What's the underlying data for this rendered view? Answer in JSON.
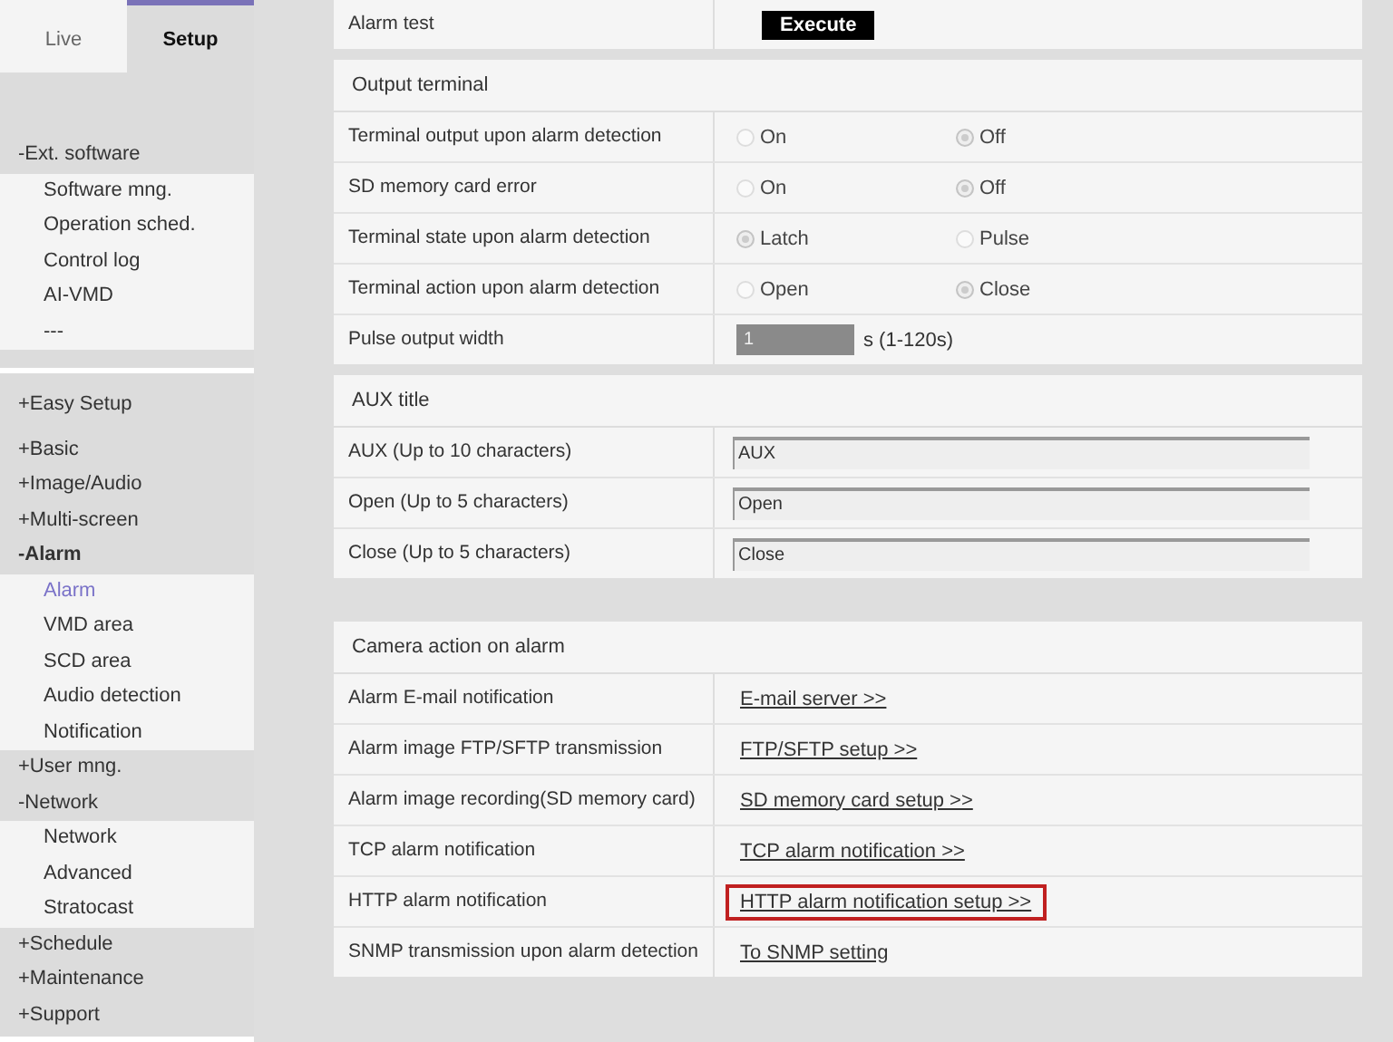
{
  "tabs": [
    {
      "label": "Live",
      "selected": false
    },
    {
      "label": "Setup",
      "selected": true
    }
  ],
  "sidebar": {
    "groups": [
      {
        "sections": [
          {
            "label": "-Ext. software",
            "selected": false,
            "children": [
              {
                "label": "Software mng.",
                "selected": false
              },
              {
                "label": "Operation sched.",
                "selected": false
              },
              {
                "label": "Control log",
                "selected": false
              },
              {
                "label": "AI-VMD",
                "selected": false
              },
              {
                "label": "---",
                "selected": false
              }
            ]
          }
        ]
      },
      {
        "sections": [
          {
            "label": "+Easy Setup",
            "selected": false
          }
        ]
      },
      {
        "sections": [
          {
            "label": "+Basic",
            "selected": false
          },
          {
            "label": "+Image/Audio",
            "selected": false
          },
          {
            "label": "+Multi-screen",
            "selected": false
          },
          {
            "label": "-Alarm",
            "selected": true,
            "children": [
              {
                "label": "Alarm",
                "selected": true
              },
              {
                "label": "VMD area",
                "selected": false
              },
              {
                "label": "SCD area",
                "selected": false
              },
              {
                "label": "Audio detection",
                "selected": false
              },
              {
                "label": "Notification",
                "selected": false
              }
            ]
          },
          {
            "label": "+User mng.",
            "selected": false
          },
          {
            "label": "-Network",
            "selected": false,
            "children": [
              {
                "label": "Network",
                "selected": false
              },
              {
                "label": "Advanced",
                "selected": false
              },
              {
                "label": "Stratocast",
                "selected": false
              }
            ]
          },
          {
            "label": "+Schedule",
            "selected": false
          },
          {
            "label": "+Maintenance",
            "selected": false
          },
          {
            "label": "+Support",
            "selected": false
          }
        ]
      }
    ]
  },
  "panels": [
    {
      "rows": [
        {
          "kind": "button",
          "label": "Alarm test",
          "button": "Execute"
        }
      ]
    },
    {
      "title": "Output terminal",
      "rows": [
        {
          "kind": "radio",
          "label": "Terminal output upon alarm detection",
          "options": [
            {
              "label": "On",
              "selected": false
            },
            {
              "label": "Off",
              "selected": true
            }
          ]
        },
        {
          "kind": "radio",
          "label": "SD memory card error",
          "options": [
            {
              "label": "On",
              "selected": false
            },
            {
              "label": "Off",
              "selected": true
            }
          ]
        },
        {
          "kind": "radio",
          "label": "Terminal state upon alarm detection",
          "options": [
            {
              "label": "Latch",
              "selected": true
            },
            {
              "label": "Pulse",
              "selected": false
            }
          ]
        },
        {
          "kind": "radio",
          "label": "Terminal action upon alarm detection",
          "options": [
            {
              "label": "Open",
              "selected": false
            },
            {
              "label": "Close",
              "selected": true
            }
          ]
        },
        {
          "kind": "number",
          "label": "Pulse output width",
          "value": "1",
          "disabled": true,
          "suffix": "s (1-120s)"
        }
      ]
    },
    {
      "title": "AUX title",
      "rows": [
        {
          "kind": "text",
          "label": "AUX (Up to 10 characters)",
          "value": "AUX"
        },
        {
          "kind": "text",
          "label": "Open (Up to 5 characters)",
          "value": "Open"
        },
        {
          "kind": "text",
          "label": "Close (Up to 5 characters)",
          "value": "Close"
        }
      ]
    },
    {
      "title": "Camera action on alarm",
      "rows": [
        {
          "kind": "link",
          "label": "Alarm E-mail notification",
          "link": "E-mail server >>",
          "highlighted": false
        },
        {
          "kind": "link",
          "label": "Alarm image FTP/SFTP transmission",
          "link": "FTP/SFTP setup >>",
          "highlighted": false
        },
        {
          "kind": "link",
          "label": "Alarm image recording(SD memory card)",
          "link": "SD memory card setup >>",
          "highlighted": false
        },
        {
          "kind": "link",
          "label": "TCP alarm notification",
          "link": "TCP alarm notification >>",
          "highlighted": false
        },
        {
          "kind": "link",
          "label": "HTTP alarm notification",
          "link": "HTTP alarm notification setup >>",
          "highlighted": true
        },
        {
          "kind": "link",
          "label": "SNMP transmission upon alarm detection",
          "link": "To SNMP setting",
          "highlighted": false
        }
      ]
    }
  ]
}
